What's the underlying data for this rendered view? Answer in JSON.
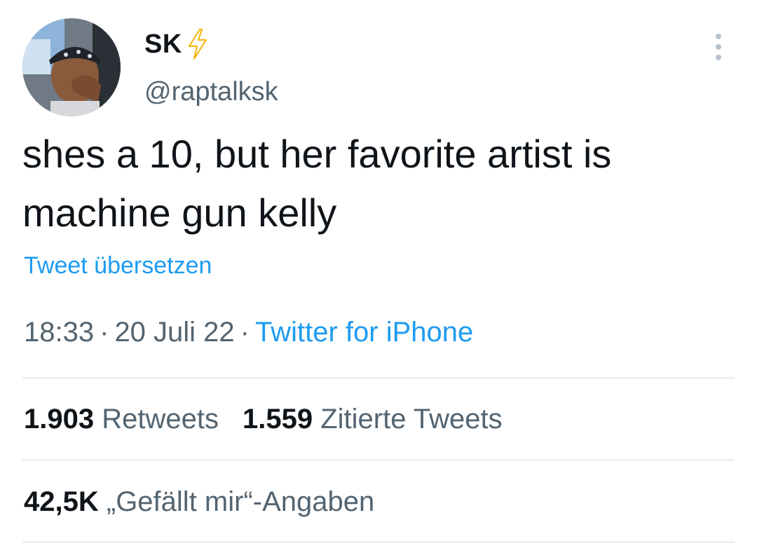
{
  "author": {
    "display_name": "SK",
    "handle": "@raptalksk",
    "badge_icon": "lightning-bolt-icon",
    "badge_color": "#f4b400"
  },
  "tweet": {
    "text_line_1": "shes a 10, but her favorite artist is",
    "text_line_2": "machine gun kelly",
    "translate_label": "Tweet übersetzen"
  },
  "meta": {
    "time": "18:33",
    "separator_1": "·",
    "date": "20 Juli 22",
    "separator_2": "·",
    "source": "Twitter for iPhone"
  },
  "stats": {
    "retweets_count": "1.903",
    "retweets_label": "Retweets",
    "quotes_count": "1.559",
    "quotes_label": "Zitierte Tweets",
    "likes_count": "42,5K",
    "likes_label": "„Gefällt mir“-Angaben"
  },
  "colors": {
    "link": "#1d9bf0",
    "secondary_text": "#536471",
    "primary_text": "#0f1419",
    "divider": "#cfd9de"
  },
  "icons": {
    "more": "more-vertical-icon"
  }
}
